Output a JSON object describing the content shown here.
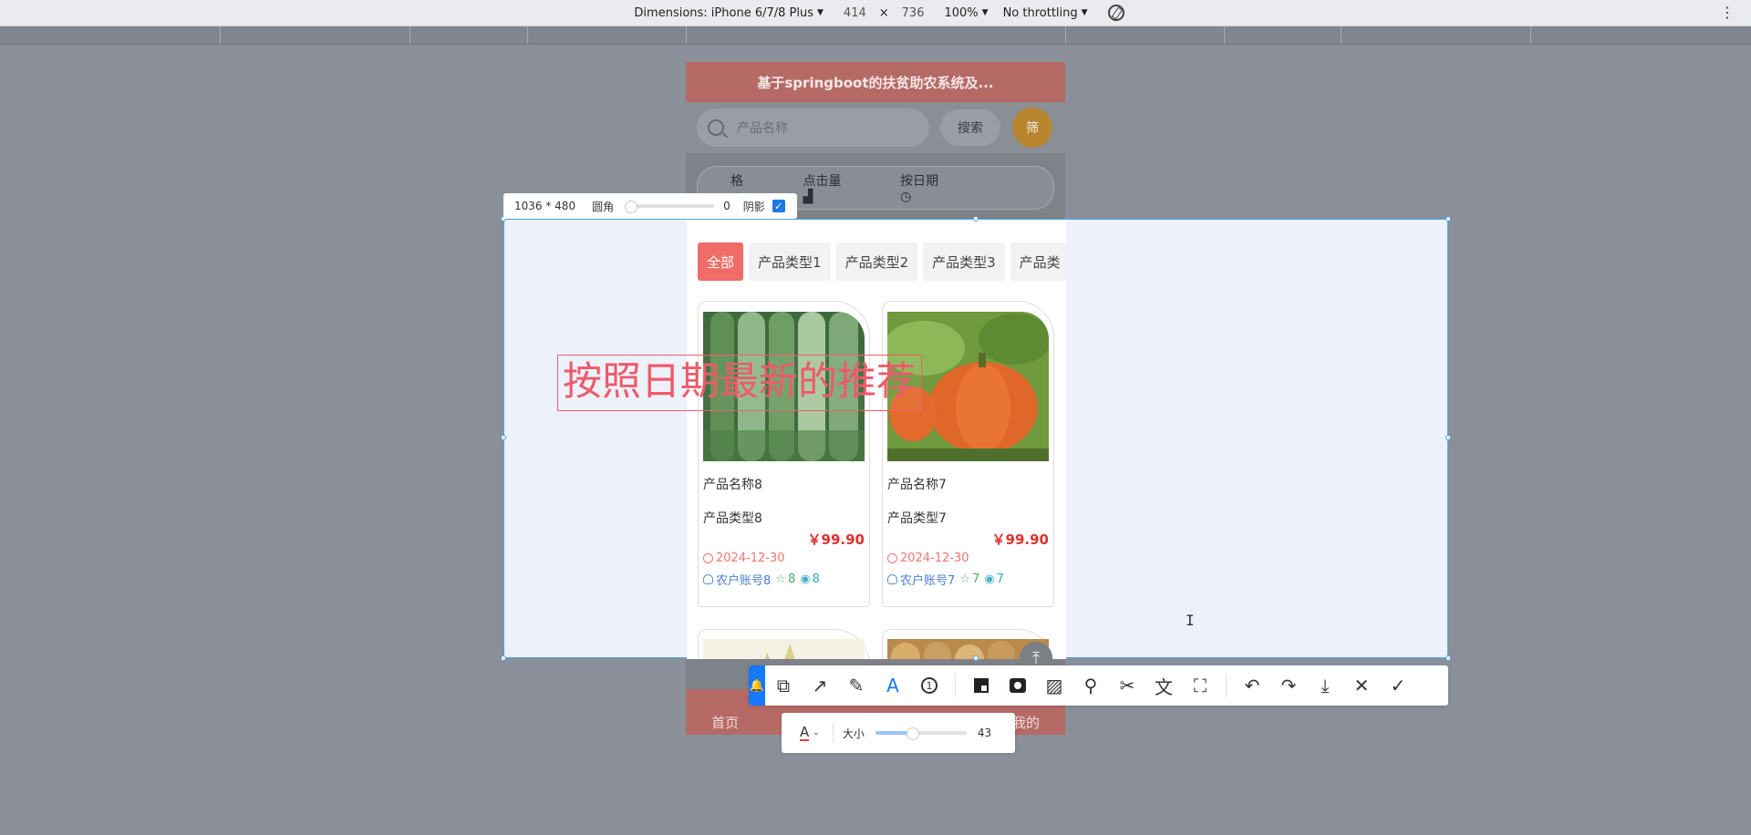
{
  "devtools": {
    "dimensions_label": "Dimensions: iPhone 6/7/8 Plus",
    "width": "414",
    "times": "×",
    "height": "736",
    "zoom": "100%",
    "throttling": "No throttling"
  },
  "app": {
    "title": "基于springboot的扶贫助农系统及...",
    "search_placeholder": "产品名称",
    "search_button": "搜索",
    "filter_button": "筛",
    "sort_options": [
      "格",
      "点击量",
      "按日期"
    ]
  },
  "categories": [
    "全部",
    "产品类型1",
    "产品类型2",
    "产品类型3",
    "产品类"
  ],
  "products": [
    {
      "name": "产品名称8",
      "type": "产品类型8",
      "price": "￥99.90",
      "date": "2024-12-30",
      "account": "农户账号8",
      "favorites": "8",
      "views": "8"
    },
    {
      "name": "产品名称7",
      "type": "产品类型7",
      "price": "￥99.90",
      "date": "2024-12-30",
      "account": "农户账号7",
      "favorites": "7",
      "views": "7"
    }
  ],
  "bottom_nav": {
    "home": "首页",
    "mine": "我的"
  },
  "screenshot_tool": {
    "size": "1036 * 480",
    "corner_label": "圆角",
    "corner_value": "0",
    "shadow_label": "阴影",
    "annotation_text": "按照日期最新的推荐",
    "text_color_letter": "A",
    "font_size_label": "大小",
    "font_size_value": "43"
  },
  "colors": {
    "accent": "#1677ff",
    "brand": "#ef6c68",
    "price": "#e0302c"
  }
}
